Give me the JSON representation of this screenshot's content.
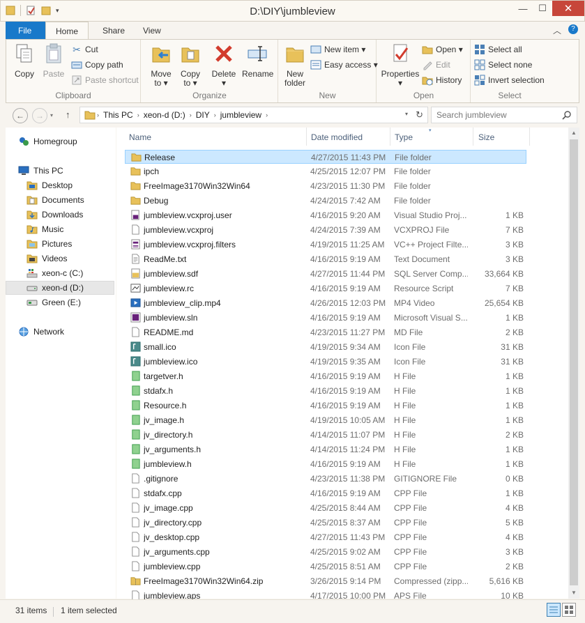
{
  "window": {
    "title": "D:\\DIY\\jumbleview",
    "minimize": "—",
    "maximize": "☐",
    "close": "✕"
  },
  "ribbon_tabs": {
    "file": "File",
    "home": "Home",
    "share": "Share",
    "view": "View"
  },
  "ribbon": {
    "clipboard": {
      "label": "Clipboard",
      "copy": "Copy",
      "paste": "Paste",
      "cut": "Cut",
      "copy_path": "Copy path",
      "paste_shortcut": "Paste shortcut"
    },
    "organize": {
      "label": "Organize",
      "move_to": "Move",
      "move_to_2": "to ▾",
      "copy_to": "Copy",
      "copy_to_2": "to ▾",
      "delete": "Delete",
      "delete_2": "▾",
      "rename": "Rename"
    },
    "new": {
      "label": "New",
      "new_folder": "New",
      "new_folder_2": "folder",
      "new_item": "New item ▾",
      "easy_access": "Easy access ▾"
    },
    "open": {
      "label": "Open",
      "properties": "Properties",
      "properties_2": "▾",
      "open": "Open ▾",
      "edit": "Edit",
      "history": "History"
    },
    "select": {
      "label": "Select",
      "select_all": "Select all",
      "select_none": "Select none",
      "invert_selection": "Invert selection"
    }
  },
  "address": {
    "crumbs": [
      "This PC",
      "xeon-d (D:)",
      "DIY",
      "jumbleview"
    ],
    "search_placeholder": "Search jumbleview"
  },
  "nav_pane": {
    "homegroup": "Homegroup",
    "this_pc": "This PC",
    "desktop": "Desktop",
    "documents": "Documents",
    "downloads": "Downloads",
    "music": "Music",
    "pictures": "Pictures",
    "videos": "Videos",
    "drive_c": "xeon-c (C:)",
    "drive_d": "xeon-d (D:)",
    "drive_e": "Green (E:)",
    "network": "Network"
  },
  "columns": {
    "name": "Name",
    "date_modified": "Date modified",
    "type": "Type",
    "size": "Size"
  },
  "files": [
    {
      "name": "Release",
      "date": "4/27/2015 11:43 PM",
      "type": "File folder",
      "size": "",
      "icon": "folder"
    },
    {
      "name": "ipch",
      "date": "4/25/2015 12:07 PM",
      "type": "File folder",
      "size": "",
      "icon": "folder"
    },
    {
      "name": "FreeImage3170Win32Win64",
      "date": "4/23/2015 11:30 PM",
      "type": "File folder",
      "size": "",
      "icon": "folder"
    },
    {
      "name": "Debug",
      "date": "4/24/2015 7:42 AM",
      "type": "File folder",
      "size": "",
      "icon": "folder"
    },
    {
      "name": "jumbleview.vcxproj.user",
      "date": "4/16/2015 9:20 AM",
      "type": "Visual Studio Proj...",
      "size": "1 KB",
      "icon": "vs"
    },
    {
      "name": "jumbleview.vcxproj",
      "date": "4/24/2015 7:39 AM",
      "type": "VCXPROJ File",
      "size": "7 KB",
      "icon": "doc"
    },
    {
      "name": "jumbleview.vcxproj.filters",
      "date": "4/19/2015 11:25 AM",
      "type": "VC++ Project Filte...",
      "size": "3 KB",
      "icon": "filters"
    },
    {
      "name": "ReadMe.txt",
      "date": "4/16/2015 9:19 AM",
      "type": "Text Document",
      "size": "3 KB",
      "icon": "txt"
    },
    {
      "name": "jumbleview.sdf",
      "date": "4/27/2015 11:44 PM",
      "type": "SQL Server Comp...",
      "size": "33,664 KB",
      "icon": "sdf"
    },
    {
      "name": "jumbleview.rc",
      "date": "4/16/2015 9:19 AM",
      "type": "Resource Script",
      "size": "7 KB",
      "icon": "rc"
    },
    {
      "name": "jumbleview_clip.mp4",
      "date": "4/26/2015 12:03 PM",
      "type": "MP4 Video",
      "size": "25,654 KB",
      "icon": "video"
    },
    {
      "name": "jumbleview.sln",
      "date": "4/16/2015 9:19 AM",
      "type": "Microsoft Visual S...",
      "size": "1 KB",
      "icon": "sln"
    },
    {
      "name": "README.md",
      "date": "4/23/2015 11:27 PM",
      "type": "MD File",
      "size": "2 KB",
      "icon": "doc"
    },
    {
      "name": "small.ico",
      "date": "4/19/2015 9:34 AM",
      "type": "Icon File",
      "size": "31 KB",
      "icon": "ico"
    },
    {
      "name": "jumbleview.ico",
      "date": "4/19/2015 9:35 AM",
      "type": "Icon File",
      "size": "31 KB",
      "icon": "ico"
    },
    {
      "name": "targetver.h",
      "date": "4/16/2015 9:19 AM",
      "type": "H File",
      "size": "1 KB",
      "icon": "h"
    },
    {
      "name": "stdafx.h",
      "date": "4/16/2015 9:19 AM",
      "type": "H File",
      "size": "1 KB",
      "icon": "h"
    },
    {
      "name": "Resource.h",
      "date": "4/16/2015 9:19 AM",
      "type": "H File",
      "size": "1 KB",
      "icon": "h"
    },
    {
      "name": "jv_image.h",
      "date": "4/19/2015 10:05 AM",
      "type": "H File",
      "size": "1 KB",
      "icon": "h"
    },
    {
      "name": "jv_directory.h",
      "date": "4/14/2015 11:07 PM",
      "type": "H File",
      "size": "2 KB",
      "icon": "h"
    },
    {
      "name": "jv_arguments.h",
      "date": "4/14/2015 11:24 PM",
      "type": "H File",
      "size": "1 KB",
      "icon": "h"
    },
    {
      "name": "jumbleview.h",
      "date": "4/16/2015 9:19 AM",
      "type": "H File",
      "size": "1 KB",
      "icon": "h"
    },
    {
      "name": ".gitignore",
      "date": "4/23/2015 11:38 PM",
      "type": "GITIGNORE File",
      "size": "0 KB",
      "icon": "doc"
    },
    {
      "name": "stdafx.cpp",
      "date": "4/16/2015 9:19 AM",
      "type": "CPP File",
      "size": "1 KB",
      "icon": "doc"
    },
    {
      "name": "jv_image.cpp",
      "date": "4/25/2015 8:44 AM",
      "type": "CPP File",
      "size": "4 KB",
      "icon": "doc"
    },
    {
      "name": "jv_directory.cpp",
      "date": "4/25/2015 8:37 AM",
      "type": "CPP File",
      "size": "5 KB",
      "icon": "doc"
    },
    {
      "name": "jv_desktop.cpp",
      "date": "4/27/2015 11:43 PM",
      "type": "CPP File",
      "size": "4 KB",
      "icon": "doc"
    },
    {
      "name": "jv_arguments.cpp",
      "date": "4/25/2015 9:02 AM",
      "type": "CPP File",
      "size": "3 KB",
      "icon": "doc"
    },
    {
      "name": "jumbleview.cpp",
      "date": "4/25/2015 8:51 AM",
      "type": "CPP File",
      "size": "2 KB",
      "icon": "doc"
    },
    {
      "name": "FreeImage3170Win32Win64.zip",
      "date": "3/26/2015 9:14 PM",
      "type": "Compressed (zipp...",
      "size": "5,616 KB",
      "icon": "zip"
    },
    {
      "name": "jumbleview.aps",
      "date": "4/17/2015 10:00 PM",
      "type": "APS File",
      "size": "10 KB",
      "icon": "doc"
    }
  ],
  "selected_index": 0,
  "status": {
    "items": "31 items",
    "selected": "1 item selected"
  },
  "colors": {
    "accent": "#1979ca",
    "selection": "#cce8ff",
    "folder": "#e8c15a"
  }
}
